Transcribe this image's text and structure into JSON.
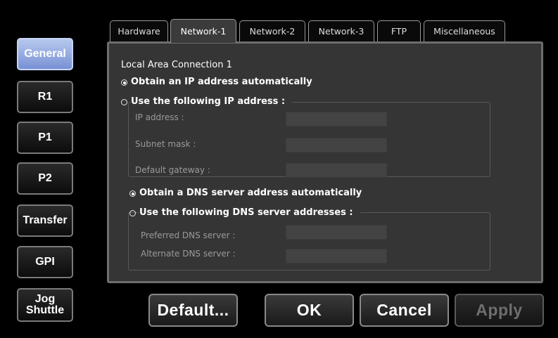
{
  "sidebar": {
    "items": [
      {
        "label": "General",
        "active": true
      },
      {
        "label": "R1"
      },
      {
        "label": "P1"
      },
      {
        "label": "P2"
      },
      {
        "label": "Transfer"
      },
      {
        "label": "GPI"
      },
      {
        "label": "Jog\nShuttle"
      }
    ]
  },
  "tabs": [
    {
      "label": "Hardware"
    },
    {
      "label": "Network-1",
      "active": true
    },
    {
      "label": "Network-2"
    },
    {
      "label": "Network-3"
    },
    {
      "label": "FTP"
    },
    {
      "label": "Miscellaneous"
    }
  ],
  "panel": {
    "heading": "Local Area Connection 1",
    "ip_auto": "Obtain an IP address automatically",
    "ip_manual": "Use the following IP address :",
    "ip_label": "IP address :",
    "ip_value": "",
    "subnet_label": "Subnet mask :",
    "subnet_value": "",
    "gateway_label": "Default gateway :",
    "gateway_value": "",
    "dns_auto": "Obtain a DNS server address automatically",
    "dns_manual": "Use the following DNS server addresses :",
    "preferred_label": "Preferred DNS server :",
    "preferred_value": "",
    "alternate_label": "Alternate DNS server :",
    "alternate_value": ""
  },
  "buttons": {
    "default": "Default...",
    "ok": "OK",
    "cancel": "Cancel",
    "apply": "Apply"
  },
  "colors": {
    "active_nav": "#8aa0e0",
    "panel_bg": "#353535"
  }
}
